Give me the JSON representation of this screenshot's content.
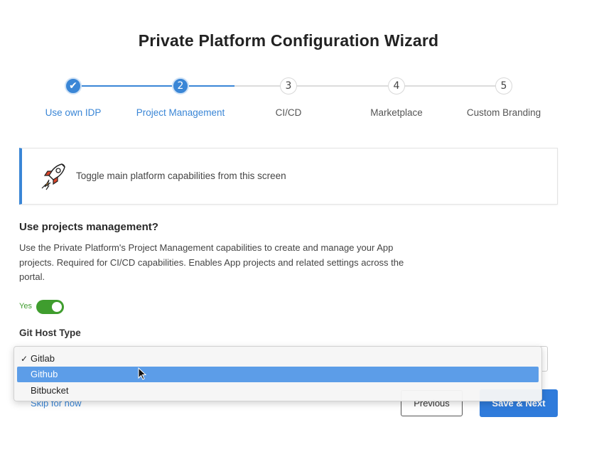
{
  "title": "Private Platform Configuration Wizard",
  "colors": {
    "accent": "#3a86d6",
    "toggle_on": "#3f9d2e",
    "primary_button": "#2f7bdb"
  },
  "steps": [
    {
      "number": "✔",
      "label": "Use own IDP",
      "state": "done"
    },
    {
      "number": "2",
      "label": "Project Management",
      "state": "active"
    },
    {
      "number": "3",
      "label": "CI/CD",
      "state": "todo"
    },
    {
      "number": "4",
      "label": "Marketplace",
      "state": "todo"
    },
    {
      "number": "5",
      "label": "Custom Branding",
      "state": "todo"
    }
  ],
  "info": {
    "icon": "rocket-icon",
    "text": "Toggle main platform capabilities from this screen"
  },
  "question": {
    "title": "Use projects management?",
    "description": "Use the Private Platform's Project Management capabilities to create and manage your App projects. Required for CI/CD capabilities. Enables App projects and related settings across the portal."
  },
  "toggle": {
    "label": "Yes",
    "on": true
  },
  "git_host": {
    "label": "Git Host Type",
    "options": [
      {
        "label": "Gitlab",
        "checked": true
      },
      {
        "label": "Github",
        "highlighted": true
      },
      {
        "label": "Bitbucket"
      }
    ]
  },
  "footer": {
    "skip": "Skip for now",
    "previous": "Previous",
    "next": "Save & Next"
  }
}
